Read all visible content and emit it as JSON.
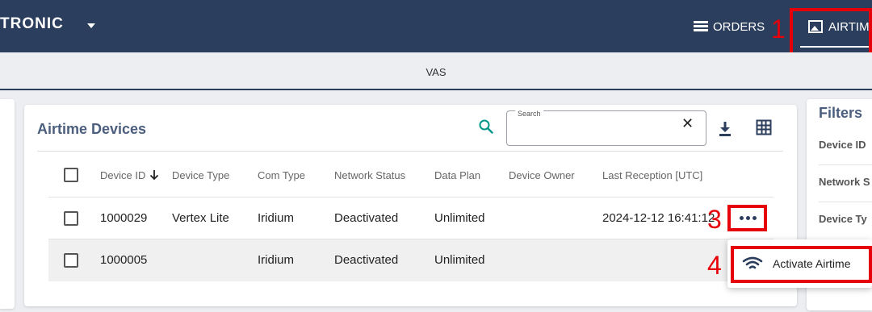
{
  "header": {
    "brand": "TRONIC",
    "nav": {
      "orders": "ORDERS",
      "airtime": "AIRTIME"
    }
  },
  "subnav": {
    "label": "VAS"
  },
  "card": {
    "title": "Airtime Devices",
    "search": {
      "legend": "Search",
      "value": "",
      "placeholder": ""
    },
    "columns": [
      "Device ID",
      "Device Type",
      "Com Type",
      "Network Status",
      "Data Plan",
      "Device Owner",
      "Last Reception [UTC]"
    ],
    "sort": {
      "column": "Device ID",
      "direction": "descending"
    },
    "rows": [
      {
        "device_id": "1000029",
        "device_type": "Vertex Lite",
        "com_type": "Iridium",
        "network_status": "Deactivated",
        "data_plan": "Unlimited",
        "device_owner": "",
        "last_reception": "2024-12-12 16:41:12"
      },
      {
        "device_id": "1000005",
        "device_type": "",
        "com_type": "Iridium",
        "network_status": "Deactivated",
        "data_plan": "Unlimited",
        "device_owner": "",
        "last_reception": ""
      }
    ]
  },
  "row_menu": {
    "items": [
      {
        "label": "Activate Airtime",
        "icon": "wifi-icon"
      }
    ]
  },
  "filters": {
    "title": "Filters",
    "fields": [
      "Device ID",
      "Network S",
      "Device Ty"
    ]
  },
  "callouts": [
    "1",
    "3",
    "4"
  ],
  "colors": {
    "header_bg": "#2c3e5d",
    "accent": "#009688",
    "callout": "#e5000a"
  }
}
